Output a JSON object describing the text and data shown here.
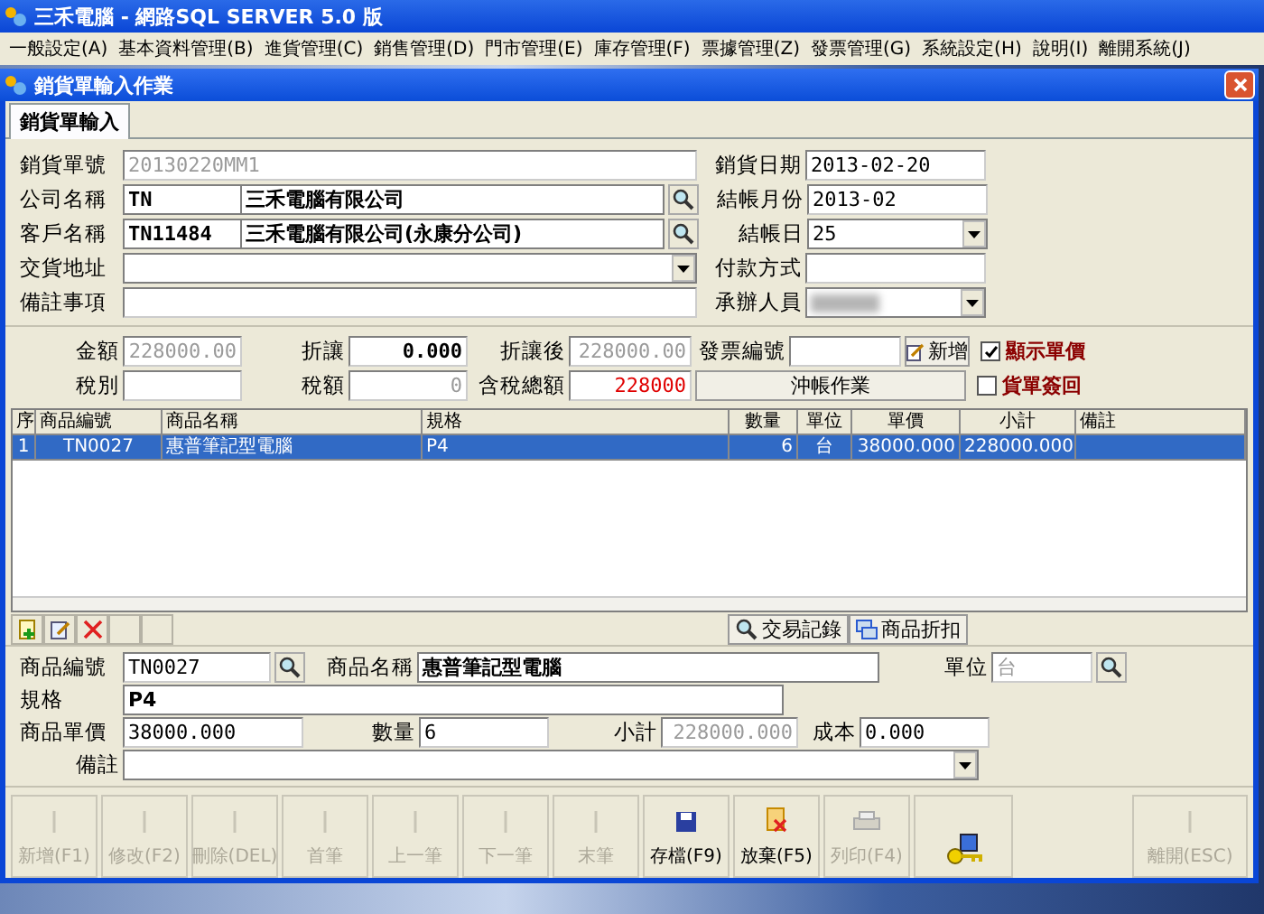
{
  "app": {
    "title": "三禾電腦 - 網路SQL SERVER 5.0 版"
  },
  "menu": [
    "一般設定(A)",
    "基本資料管理(B)",
    "進貨管理(C)",
    "銷售管理(D)",
    "門市管理(E)",
    "庫存管理(F)",
    "票據管理(Z)",
    "發票管理(G)",
    "系統設定(H)",
    "說明(I)",
    "離開系統(J)"
  ],
  "window": {
    "title": "銷貨單輸入作業"
  },
  "tabs": [
    {
      "label": "銷貨單輸入",
      "selected": true
    }
  ],
  "header": {
    "order_no": {
      "label": "銷貨單號",
      "value": "20130220MM1",
      "disabled": true
    },
    "company": {
      "label": "公司名稱",
      "code": "TN",
      "name": "三禾電腦有限公司"
    },
    "customer": {
      "label": "客戶名稱",
      "code": "TN11484",
      "name": "三禾電腦有限公司(永康分公司)"
    },
    "address": {
      "label": "交貨地址"
    },
    "memo": {
      "label": "備註事項"
    },
    "sale_date": {
      "label": "銷貨日期",
      "value": "2013-02-20"
    },
    "month": {
      "label": "結帳月份",
      "value": "2013-02"
    },
    "closing_day": {
      "label": "結帳日",
      "value": "25"
    },
    "payment": {
      "label": "付款方式"
    },
    "handler": {
      "label": "承辦人員"
    }
  },
  "summary": {
    "amount": {
      "label": "金額",
      "value": "228000.00",
      "disabled": true
    },
    "discount": {
      "label": "折讓",
      "value": "0.000",
      "disabled": false
    },
    "after_discount": {
      "label": "折讓後",
      "value": "228000.00",
      "disabled": true
    },
    "invoice": {
      "label": "發票編號"
    },
    "new_button": "新增",
    "tax_type": {
      "label": "稅別"
    },
    "tax": {
      "label": "稅額",
      "value": "0",
      "disabled": true
    },
    "total": {
      "label": "含稅總額",
      "value": "228000",
      "disabled": false
    },
    "settle_button": "沖帳作業",
    "checks": [
      {
        "label": "顯示單價",
        "checked": true
      },
      {
        "label": "貨單簽回",
        "checked": false
      }
    ]
  },
  "grid": {
    "columns": [
      "序",
      "商品編號",
      "商品名稱",
      "規格",
      "數量",
      "單位",
      "單價",
      "小計",
      "備註"
    ],
    "rows": [
      {
        "selected": true,
        "cells": [
          "1",
          "TN0027",
          "惠普筆記型電腦",
          "P4",
          "6",
          "台",
          "38000.000",
          "228000.000",
          ""
        ]
      }
    ]
  },
  "detail_tools": [
    "交易記錄",
    "商品折扣"
  ],
  "detail": {
    "code": {
      "label": "商品編號",
      "value": "TN0027"
    },
    "name": {
      "label": "商品名稱",
      "value": "惠普筆記型電腦"
    },
    "unit": {
      "label": "單位",
      "value": "台",
      "disabled": true
    },
    "spec": {
      "label": "規格",
      "value": "P4"
    },
    "price": {
      "label": "商品單價",
      "value": "38000.000"
    },
    "qty": {
      "label": "數量",
      "value": "6"
    },
    "subtotal": {
      "label": "小計",
      "value": "228000.000",
      "disabled": true
    },
    "cost": {
      "label": "成本",
      "value": "0.000"
    },
    "note": {
      "label": "備註"
    }
  },
  "buttons": [
    {
      "kind": "add",
      "label": "新增(F1)",
      "disabled": true
    },
    {
      "kind": "edit",
      "label": "修改(F2)",
      "disabled": true
    },
    {
      "kind": "delete",
      "label": "刪除(DEL)",
      "disabled": true
    },
    {
      "kind": "first",
      "label": "首筆",
      "disabled": true
    },
    {
      "kind": "prev",
      "label": "上一筆",
      "disabled": true
    },
    {
      "kind": "next",
      "label": "下一筆",
      "disabled": true
    },
    {
      "kind": "last",
      "label": "末筆",
      "disabled": true
    },
    {
      "kind": "save",
      "label": "存檔(F9)",
      "disabled": false
    },
    {
      "kind": "cancel",
      "label": "放棄(F5)",
      "disabled": false
    },
    {
      "kind": "print",
      "label": "列印(F4)",
      "disabled": true
    },
    {
      "kind": "key"
    },
    {
      "kind": "spacer"
    },
    {
      "kind": "exit",
      "label": "離開(ESC)",
      "disabled": true
    }
  ]
}
